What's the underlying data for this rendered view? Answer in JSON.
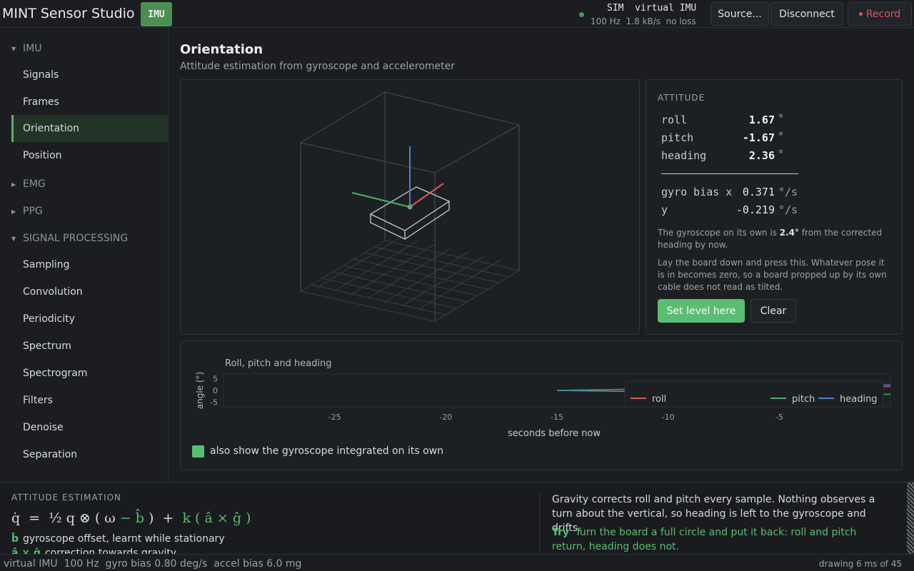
{
  "header": {
    "app_title": "MINT Sensor Studio",
    "badge": "IMU",
    "source_line1": "SIM  virtual IMU",
    "source_line2": "100 Hz  1.8 kB/s  no loss",
    "source_button": "Source...",
    "disconnect_button": "Disconnect",
    "record_button": "Record"
  },
  "sidebar": {
    "imu_group": "IMU",
    "imu_items": [
      "Signals",
      "Frames",
      "Orientation",
      "Position"
    ],
    "emg_group": "EMG",
    "ppg_group": "PPG",
    "sp_group": "SIGNAL PROCESSING",
    "sp_items": [
      "Sampling",
      "Convolution",
      "Periodicity",
      "Spectrum",
      "Spectrogram",
      "Filters",
      "Denoise",
      "Separation"
    ]
  },
  "page": {
    "title": "Orientation",
    "subtitle": "Attitude estimation from gyroscope and accelerometer"
  },
  "attitude": {
    "caption": "ATTITUDE",
    "roll_label": "roll",
    "roll_value": "1.67",
    "pitch_label": "pitch",
    "pitch_value": "-1.67",
    "heading_label": "heading",
    "heading_value": "2.36",
    "deg_unit": "°",
    "bias_label_x": "gyro bias x",
    "bias_x": "0.371",
    "bias_label_y": "y",
    "bias_y": "-0.219",
    "bias_unit": "°/s",
    "note1_pre": "The gyroscope on its own is ",
    "note1_val": "2.4°",
    "note1_post": " from the corrected heading by now.",
    "note2": "Lay the board down and press this. Whatever pose it is in becomes zero, so a board propped up by its own cable does not read as tilted.",
    "level_button": "Set level here",
    "clear_button": "Clear"
  },
  "chart_data": {
    "type": "line",
    "title": "Roll, pitch and heading",
    "xlabel": "seconds before now",
    "ylabel": "angle (°)",
    "xlim": [
      -30,
      0
    ],
    "ylim": [
      -7,
      7
    ],
    "x_ticks": [
      -25,
      -20,
      -15,
      -10,
      -5
    ],
    "y_ticks": [
      5,
      0,
      -5
    ],
    "legend_position": "right",
    "series": [
      {
        "name": "roll",
        "color": "#d85a5e",
        "x": [
          -15.0,
          -12.0,
          -8.0,
          -5.0,
          -2.0,
          -1.0,
          -0.5,
          0
        ],
        "y": [
          0.0,
          0.4,
          0.8,
          1.1,
          1.5,
          1.6,
          1.67,
          1.67
        ]
      },
      {
        "name": "pitch",
        "color": "#4fae66",
        "x": [
          -15.0,
          -12.0,
          -8.0,
          -5.0,
          -2.0,
          -1.0,
          -0.5,
          0
        ],
        "y": [
          0.0,
          -0.4,
          -0.8,
          -1.1,
          -1.5,
          -1.6,
          -1.67,
          -1.67
        ]
      },
      {
        "name": "heading",
        "color": "#4a7fd1",
        "x": [
          -15.0,
          -12.0,
          -8.0,
          -5.0,
          -2.0,
          -1.0,
          -0.5,
          0
        ],
        "y": [
          0.0,
          0.5,
          1.0,
          1.5,
          2.0,
          2.2,
          2.3,
          2.36
        ]
      }
    ]
  },
  "chart_option": {
    "gyro_label": "also show the gyroscope integrated on its own"
  },
  "bottom": {
    "caption": "ATTITUDE ESTIMATION",
    "formula_a": "q̇  =  ½ q ⊗ ( ω ",
    "formula_b": "− b̂",
    "formula_c": " )  +  ",
    "formula_d": "k ( â × ĝ )",
    "legend1_sym": "b̂",
    "legend1_text": "gyroscope offset, learnt while stationary",
    "legend2_sym": "â × ĝ",
    "legend2_text": "correction towards gravity",
    "explain": "Gravity corrects roll and pitch every sample. Nothing observes a turn about the vertical, so heading is left to the gyroscope and drifts.",
    "try_label": "Try",
    "try_text": "Turn the board a full circle and put it back: roll and pitch return, heading does not."
  },
  "statusbar": {
    "left": "virtual IMU  100 Hz  gyro bias 0.80 deg/s  accel bias 6.0 mg",
    "right": "drawing 6 ms of 45"
  }
}
